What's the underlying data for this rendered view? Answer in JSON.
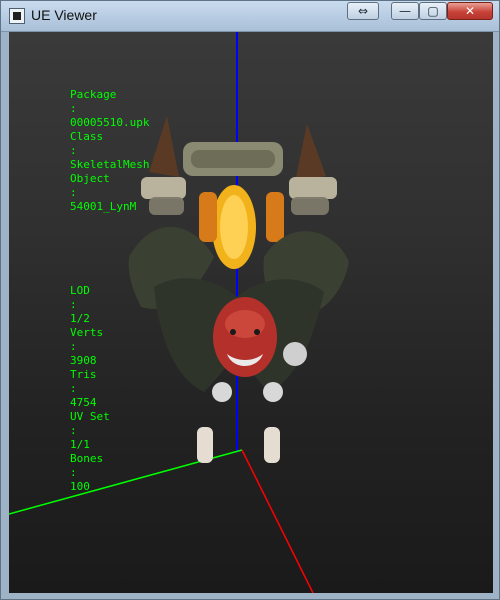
{
  "window": {
    "title": "UE Viewer",
    "buttons": {
      "restore": "⇔",
      "minimize": "—",
      "maximize": "▢",
      "close": "✕"
    }
  },
  "viewport": {
    "info": {
      "package": {
        "key": "Package",
        "value": "00005510.upk"
      },
      "class": {
        "key": "Class",
        "value": "SkeletalMesh"
      },
      "object": {
        "key": "Object",
        "value": "54001_LynM"
      },
      "lod": {
        "key": "LOD",
        "value": "1/2"
      },
      "verts": {
        "key": "Verts",
        "value": "3908"
      },
      "tris": {
        "key": "Tris",
        "value": "4754"
      },
      "uvset": {
        "key": "UV Set",
        "value": "1/1"
      },
      "bones": {
        "key": "Bones",
        "value": "100"
      }
    },
    "axis_colors": {
      "x": "#ff0000",
      "y": "#00ff00",
      "z": "#0000ff"
    }
  }
}
